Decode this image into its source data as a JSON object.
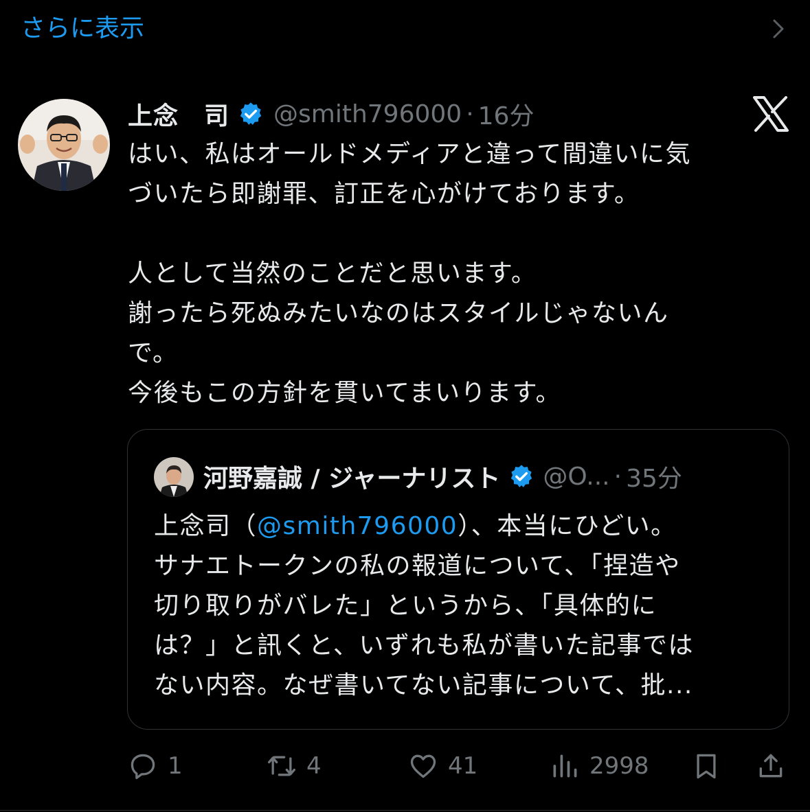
{
  "show_more": {
    "label": "さらに表示"
  },
  "tweet": {
    "author_name": "上念　司",
    "handle": "@smith796000",
    "separator": "·",
    "time": "16分",
    "paragraphs": [
      "はい、私はオールドメディアと違って間違いに気",
      "づいたら即謝罪、訂正を心がけております。",
      "",
      "人として当然のことだと思います。",
      "謝ったら死ぬみたいなのはスタイルじゃないん",
      "で。",
      "今後もこの方針を貫いてまいります。"
    ]
  },
  "quoted_tweet": {
    "author_name": "河野嘉誠 / ジャーナリスト",
    "handle": "@O...",
    "separator": "·",
    "time": "35分",
    "line1_prefix": "上念司（",
    "line1_mention": "@smith796000",
    "line1_suffix": "）、本当にひどい。",
    "lines": [
      "サナエトークンの私の報道について、「捏造や",
      "切り取りがバレた」というから、「具体的に",
      "は？」と訊くと、いずれも私が書いた記事では",
      "ない内容。なぜ書いてない記事について、批..."
    ]
  },
  "actions": {
    "reply_count": "1",
    "retweet_count": "4",
    "like_count": "41",
    "view_count": "2998"
  },
  "colors": {
    "background": "#000000",
    "text": "#e7e9ea",
    "muted": "#71767b",
    "accent": "#1d9bf0",
    "border": "#2f3336"
  },
  "icons": [
    "chevron-right-icon",
    "verified-badge-icon",
    "x-logo-icon",
    "reply-icon",
    "retweet-icon",
    "like-icon",
    "views-icon",
    "bookmark-icon",
    "share-icon"
  ]
}
